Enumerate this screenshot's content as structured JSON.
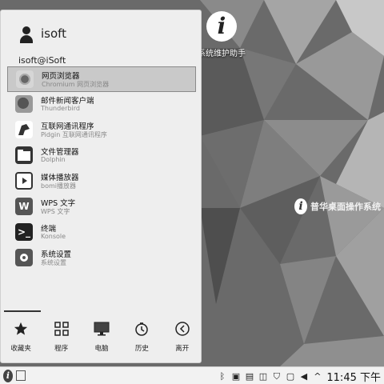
{
  "desktop": {
    "icon": {
      "glyph": "i",
      "label": "系统维护助手"
    },
    "brand": {
      "glyph": "i",
      "text": "普华桌面操作系统"
    }
  },
  "user": {
    "name": "isoft",
    "id": "isoft@iSoft"
  },
  "apps": [
    {
      "name": "网页浏览器",
      "desc": "Chromium 网页浏览器",
      "icon": "chromium-icon",
      "selected": true
    },
    {
      "name": "邮件新闻客户端",
      "desc": "Thunderbird",
      "icon": "thunderbird-icon"
    },
    {
      "name": "互联网通讯程序",
      "desc": "Pidgin 互联网通讯程序",
      "icon": "pidgin-icon"
    },
    {
      "name": "文件管理器",
      "desc": "Dolphin",
      "icon": "dolphin-icon"
    },
    {
      "name": "媒体播放器",
      "desc": "bomi播放器",
      "icon": "bomi-icon"
    },
    {
      "name": "WPS 文字",
      "desc": "WPS 文字",
      "icon": "wps-icon"
    },
    {
      "name": "终端",
      "desc": "Konsole",
      "icon": "konsole-icon"
    },
    {
      "name": "系统设置",
      "desc": "系统设置",
      "icon": "settings-icon"
    }
  ],
  "tabs": [
    {
      "label": "收藏夹",
      "icon": "star-icon"
    },
    {
      "label": "程序",
      "icon": "grid-icon"
    },
    {
      "label": "电脑",
      "icon": "monitor-icon"
    },
    {
      "label": "历史",
      "icon": "clock-icon"
    },
    {
      "label": "离开",
      "icon": "leave-icon"
    }
  ],
  "taskbar": {
    "start_glyph": "i",
    "clock": "11:45 下午",
    "tray_icons": [
      "bluetooth-icon",
      "updater-icon",
      "clipboard-icon",
      "network-icon",
      "security-icon",
      "notification-icon",
      "volume-icon",
      "expand-tray-icon"
    ]
  }
}
